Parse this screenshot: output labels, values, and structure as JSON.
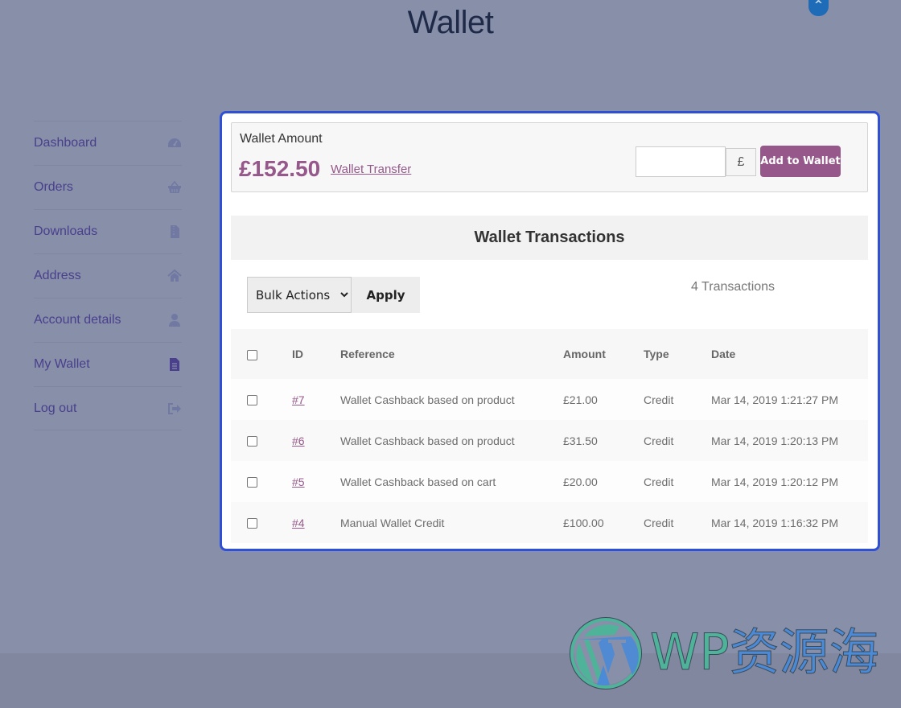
{
  "page": {
    "title": "Wallet"
  },
  "scroll_top": {
    "icon": "chevron-up-icon",
    "glyph": "^"
  },
  "sidebar": {
    "items": [
      {
        "label": "Dashboard",
        "icon": "dashboard-gauge-icon",
        "active": false
      },
      {
        "label": "Orders",
        "icon": "shopping-basket-icon",
        "active": false
      },
      {
        "label": "Downloads",
        "icon": "file-archive-icon",
        "active": false
      },
      {
        "label": "Address",
        "icon": "home-icon",
        "active": false
      },
      {
        "label": "Account details",
        "icon": "user-icon",
        "active": false
      },
      {
        "label": "My Wallet",
        "icon": "file-text-icon",
        "active": true
      },
      {
        "label": "Log out",
        "icon": "sign-out-icon",
        "active": false
      }
    ]
  },
  "wallet": {
    "label": "Wallet Amount",
    "amount": "£152.50",
    "transfer_link": "Wallet Transfer",
    "topup_input_value": "",
    "currency_symbol": "£",
    "add_button": "Add to Wallet"
  },
  "transactions": {
    "title": "Wallet Transactions",
    "bulk_actions": {
      "selected": "Bulk Actions"
    },
    "apply_button": "Apply",
    "count_text": "4 Transactions",
    "columns": [
      "ID",
      "Reference",
      "Amount",
      "Type",
      "Date"
    ],
    "rows": [
      {
        "id": "#7",
        "reference": "Wallet Cashback based on product",
        "amount": "£21.00",
        "type": "Credit",
        "date": "Mar 14, 2019 1:21:27 PM"
      },
      {
        "id": "#6",
        "reference": "Wallet Cashback based on product",
        "amount": "£31.50",
        "type": "Credit",
        "date": "Mar 14, 2019 1:20:13 PM"
      },
      {
        "id": "#5",
        "reference": "Wallet Cashback based on cart",
        "amount": "£20.00",
        "type": "Credit",
        "date": "Mar 14, 2019 1:20:12 PM"
      },
      {
        "id": "#4",
        "reference": "Manual Wallet Credit",
        "amount": "£100.00",
        "type": "Credit",
        "date": "Mar 14, 2019 1:16:32 PM"
      }
    ]
  },
  "watermark": {
    "latin": "WP",
    "cjk": "资源海"
  },
  "colors": {
    "accent": "#96588a",
    "panel_border": "#2f4fd6",
    "background": "#878fa9",
    "nav_text": "#4a3f8c",
    "scroll_top": "#1e6bb8"
  }
}
